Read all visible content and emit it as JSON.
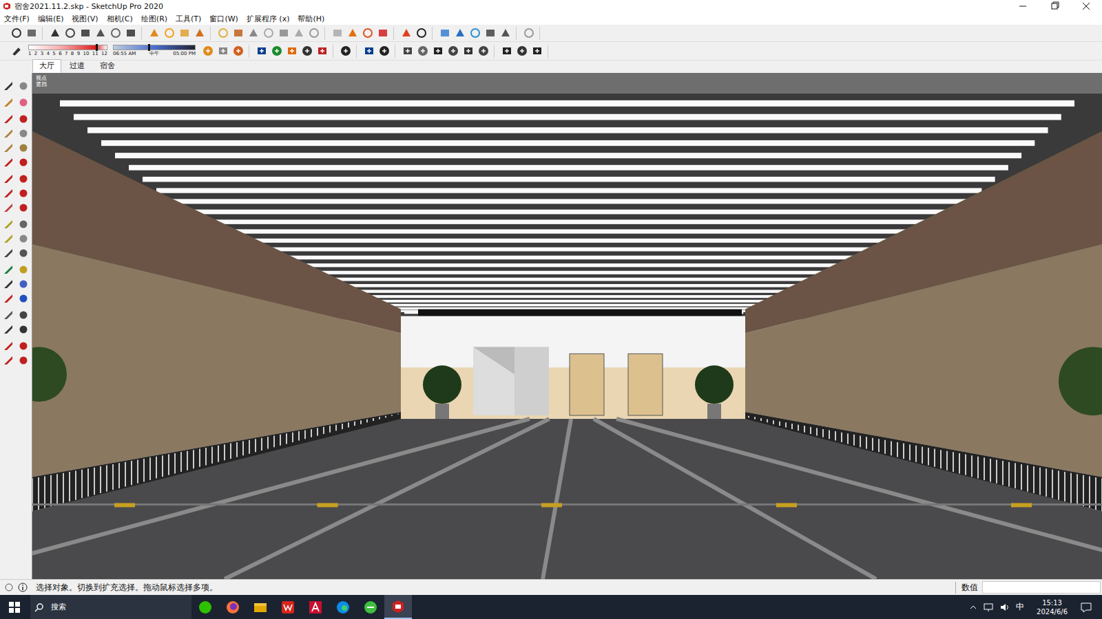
{
  "window": {
    "title": "宿舍2021.11.2.skp - SketchUp Pro 2020"
  },
  "menus": [
    "文件(F)",
    "编辑(E)",
    "视图(V)",
    "相机(C)",
    "绘图(R)",
    "工具(T)",
    "窗口(W)",
    "扩展程序 (x)",
    "帮助(H)"
  ],
  "shadow": {
    "months": [
      "1",
      "2",
      "3",
      "4",
      "5",
      "6",
      "7",
      "8",
      "9",
      "10",
      "11",
      "12"
    ],
    "month_level": 0.86,
    "times": [
      "06:55 AM",
      "中午",
      "05:00 PM"
    ],
    "time_level": 0.42
  },
  "tabs": [
    {
      "label": "大厅",
      "selected": true
    },
    {
      "label": "过道",
      "selected": false
    },
    {
      "label": "宿舍",
      "selected": false
    }
  ],
  "scene_info": [
    "视点",
    "遮挡"
  ],
  "status_bar": {
    "message": "选择对象。切换到扩充选择。拖动鼠标选择多项。",
    "value_label": "数值"
  },
  "taskbar": {
    "search": "搜索",
    "ime": "中",
    "time": "15:13",
    "date": "2024/6/6"
  }
}
